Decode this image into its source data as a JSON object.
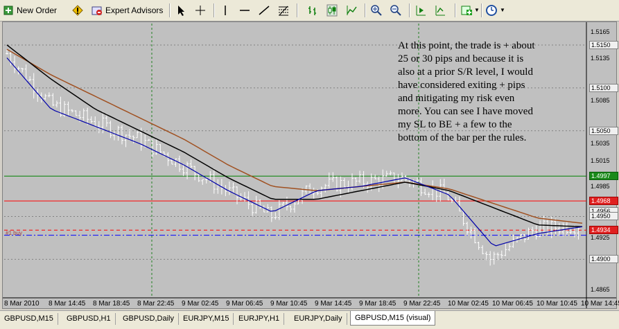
{
  "toolbar": {
    "new_order_label": "New Order",
    "expert_advisors_label": "Expert Advisors"
  },
  "annotation": "At this point, the trade is + about\n25 or 30 pips and because it is\nalso at a prior S/R level, I would\nhave considered exiting + pips\nand mitigating my risk even\nmore.  You can see I have moved\nmy SL to BE + a few to the\nbottom of the bar per the rules.",
  "order_tag": "#1 buy",
  "price_scale": {
    "labels": [
      "1.5165",
      "1.5150",
      "1.5135",
      "1.5100",
      "1.5085",
      "1.5050",
      "1.5035",
      "1.5015",
      "1.4997",
      "1.4985",
      "1.4968",
      "1.4956",
      "1.4950",
      "1.4934",
      "1.4925",
      "1.4900",
      "1.4865"
    ],
    "current_price": "1.4956",
    "green_level": "1.4997",
    "red_level_top": "1.4968",
    "red_level_bottom": "1.4934"
  },
  "time_scale": [
    "8 Mar 2010",
    "8 Mar 14:45",
    "8 Mar 18:45",
    "8 Mar 22:45",
    "9 Mar 02:45",
    "9 Mar 06:45",
    "9 Mar 10:45",
    "9 Mar 14:45",
    "9 Mar 18:45",
    "9 Mar 22:45",
    "10 Mar 02:45",
    "10 Mar 06:45",
    "10 Mar 10:45",
    "10 Mar 14:45"
  ],
  "tabs": [
    "GBPUSD,M15",
    "GBPUSD,H1",
    "GBPUSD,Daily",
    "EURJPY,M15",
    "EURJPY,H1",
    "EURJPY,Daily",
    "GBPUSD,M15 (visual)"
  ],
  "active_tab_index": 6,
  "colors": {
    "chart_bg": "#c0c0c0",
    "bar_color": "#ffffff",
    "ma_fast": "#0000aa",
    "ma_mid": "#000000",
    "ma_slow": "#a05020",
    "tp_line": "#008000",
    "sl_line": "#ff0000",
    "entry_line": "#0000ff"
  },
  "chart_data": {
    "type": "candlestick",
    "x": [
      "8 Mar 2010",
      "8 Mar 14:45",
      "8 Mar 18:45",
      "8 Mar 22:45",
      "9 Mar 02:45",
      "9 Mar 06:45",
      "9 Mar 10:45",
      "9 Mar 14:45",
      "9 Mar 18:45",
      "9 Mar 22:45",
      "10 Mar 02:45",
      "10 Mar 06:45",
      "10 Mar 10:45",
      "10 Mar 14:45"
    ],
    "close": [
      1.514,
      1.508,
      1.506,
      1.504,
      1.501,
      1.498,
      1.495,
      1.4985,
      1.499,
      1.4995,
      1.4975,
      1.49,
      1.4935,
      1.494
    ],
    "ma_fast": [
      1.5135,
      1.5075,
      1.5055,
      1.5035,
      1.501,
      1.498,
      1.4955,
      1.498,
      1.4985,
      1.4995,
      1.4975,
      1.4915,
      1.493,
      1.4938
    ],
    "ma_mid": [
      1.515,
      1.511,
      1.5075,
      1.505,
      1.5025,
      1.4995,
      1.497,
      1.497,
      1.498,
      1.499,
      1.498,
      1.496,
      1.494,
      1.4938
    ],
    "ma_slow": [
      1.5145,
      1.5115,
      1.509,
      1.5065,
      1.504,
      1.501,
      1.4985,
      1.498,
      1.4985,
      1.499,
      1.4982,
      1.4965,
      1.4948,
      1.4942
    ],
    "horizontal_levels": {
      "take_profit": 1.4997,
      "stop_loss_top": 1.4968,
      "stop_loss": 1.4934,
      "entry": 1.4928
    },
    "ylim": [
      1.4855,
      1.5175
    ]
  }
}
